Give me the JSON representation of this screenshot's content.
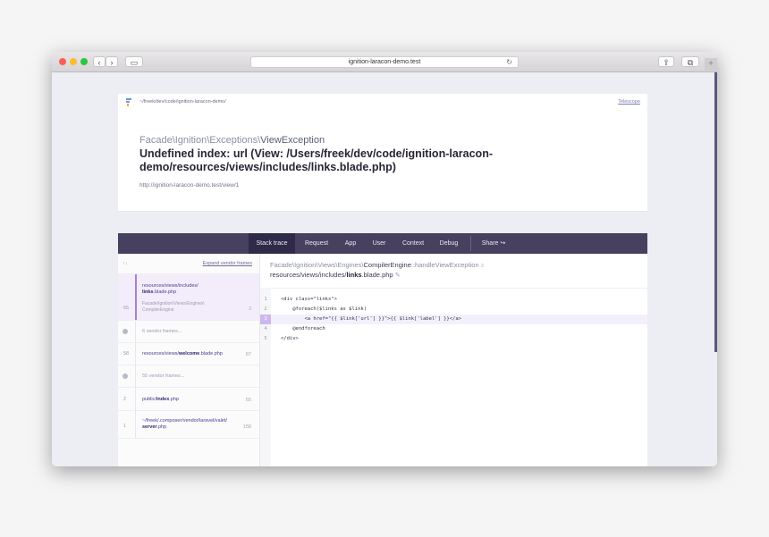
{
  "browser": {
    "url": "ignition-laracon-demo.test",
    "reload_icon": "↻",
    "back_icon": "‹",
    "forward_icon": "›",
    "sidebar_icon": "▭",
    "share_icon": "⇪",
    "tabs_icon": "⧉",
    "new_tab_icon": "+"
  },
  "header": {
    "breadcrumb": "~/freek/dev/code/ignition-laracon-demo/",
    "telescope_link": "Telescope",
    "exception_namespace": "Facade\\Ignition\\Exceptions\\",
    "exception_class": "ViewException",
    "message": "Undefined index: url (View: /Users/freek/dev/code/ignition-laracon-demo/resources/views/includes/links.blade.php)",
    "request_url": "http://ignition-laracon-demo.test/view/1"
  },
  "nav": {
    "tabs": [
      "Stack trace",
      "Request",
      "App",
      "User",
      "Context",
      "Debug"
    ],
    "share": "Share",
    "share_icon": "↪",
    "active_tab": "Stack trace"
  },
  "frames": {
    "sort_icon": "↑↓",
    "expand_label": "Expand vendor frames",
    "items": [
      {
        "num": "65",
        "path": "resources/views/includes/",
        "file": "links",
        "ext": ".blade.php",
        "cls": "Facade\\Ignition\\Views\\Engines\\",
        "method": "CompilerEngine",
        "line": "3"
      },
      {
        "vendor": "6 vendor frames..."
      },
      {
        "num": "58",
        "path": "resources/views/",
        "file": "welcome",
        "ext": ".blade.php",
        "line": "87"
      },
      {
        "vendor": "55 vendor frames..."
      },
      {
        "num": "2",
        "path": "public/",
        "file": "index",
        "ext": ".php",
        "line": "55"
      },
      {
        "num": "1",
        "path": "~/freek/.composer/vendor/laravel/valet/",
        "file": "server",
        "ext": ".php",
        "line": "158"
      }
    ]
  },
  "code": {
    "class_namespace": "Facade\\Ignition\\Views\\Engines\\",
    "class_name": "CompilerEngine",
    "method": "::handleViewException",
    "method_line": "3",
    "file_path": "resources/views/includes/",
    "file_name": "links",
    "file_ext": ".blade.php",
    "edit_icon": "✎",
    "lines": [
      {
        "no": "1",
        "text": "<div class=\"links\">"
      },
      {
        "no": "2",
        "text": "    @foreach($links as $link)"
      },
      {
        "no": "3",
        "text": "        <a href=\"{{ $link['url'] }}\">{{ $link['label'] }}</a>"
      },
      {
        "no": "4",
        "text": "    @endforeach"
      },
      {
        "no": "5",
        "text": "</div>"
      }
    ],
    "highlighted_line": "3"
  },
  "colors": {
    "nav_bg": "#47415f",
    "nav_active": "#2f2a47",
    "accent": "#a580d6"
  }
}
